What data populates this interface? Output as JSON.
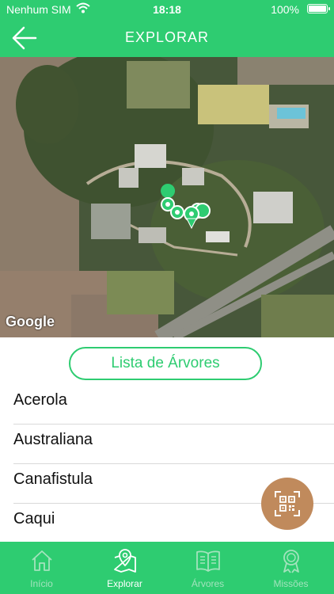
{
  "status_bar": {
    "carrier": "Nenhum SIM",
    "time": "18:18",
    "battery": "100%",
    "battery_level": 1.0
  },
  "header": {
    "title": "EXPLORAR"
  },
  "map": {
    "attribution": "Google"
  },
  "tree_list_button": {
    "label": "Lista de Árvores"
  },
  "trees": [
    {
      "name": "Acerola"
    },
    {
      "name": "Australiana"
    },
    {
      "name": "Canafistula"
    },
    {
      "name": "Caqui"
    }
  ],
  "tabs": [
    {
      "label": "Início",
      "icon": "home-icon",
      "active": false
    },
    {
      "label": "Explorar",
      "icon": "map-pin-icon",
      "active": true
    },
    {
      "label": "Árvores",
      "icon": "book-icon",
      "active": false
    },
    {
      "label": "Missões",
      "icon": "badge-icon",
      "active": false
    }
  ],
  "colors": {
    "brand_green": "#2ecc71",
    "qr_button": "#c08a5c",
    "tab_inactive": "#a3e3bd"
  }
}
